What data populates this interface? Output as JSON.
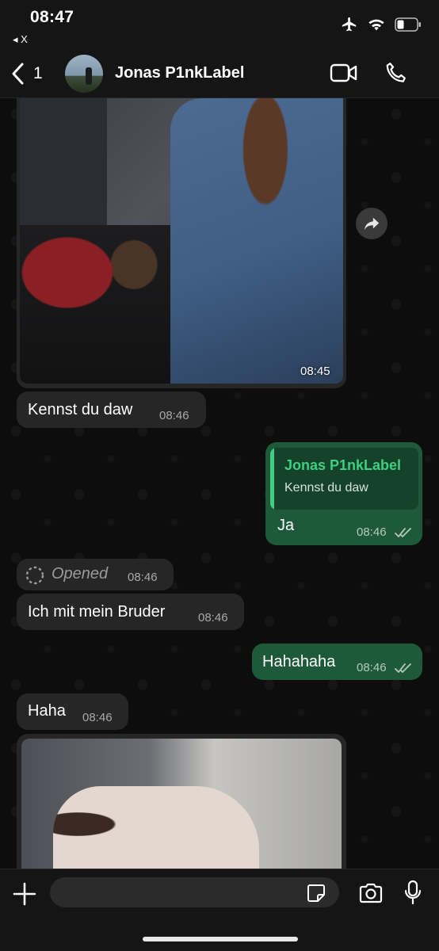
{
  "status_bar": {
    "time": "08:47",
    "back_app_label": "◂ X"
  },
  "header": {
    "back_count": "1",
    "contact_name": "Jonas P1nkLabel"
  },
  "messages": [
    {
      "type": "image",
      "direction": "incoming",
      "time": "08:45"
    },
    {
      "type": "text",
      "direction": "incoming",
      "text": "Kennst du daw",
      "time": "08:46"
    },
    {
      "type": "reply",
      "direction": "outgoing",
      "quoted_author": "Jonas P1nkLabel",
      "quoted_text": "Kennst du daw",
      "text": "Ja",
      "time": "08:46",
      "status": "read"
    },
    {
      "type": "view_once",
      "direction": "incoming",
      "text": "Opened",
      "time": "08:46"
    },
    {
      "type": "text",
      "direction": "incoming",
      "text": "Ich mit mein Bruder",
      "time": "08:46"
    },
    {
      "type": "text",
      "direction": "outgoing",
      "text": "Hahahaha",
      "time": "08:46",
      "status": "read"
    },
    {
      "type": "text",
      "direction": "incoming",
      "text": "Haha",
      "time": "08:46"
    },
    {
      "type": "image",
      "direction": "incoming",
      "time": ""
    }
  ],
  "composer": {
    "placeholder": ""
  },
  "icons": [
    "airplane-icon",
    "wifi-icon",
    "battery-icon",
    "back-chevron-icon",
    "video-call-icon",
    "phone-icon",
    "forward-icon",
    "plus-icon",
    "sticker-icon",
    "camera-icon",
    "microphone-icon",
    "double-check-icon"
  ],
  "colors": {
    "incoming_bubble": "#262626",
    "outgoing_bubble": "#1e5a3a",
    "quote_accent": "#3fcf7f",
    "bar_background": "#151515"
  }
}
